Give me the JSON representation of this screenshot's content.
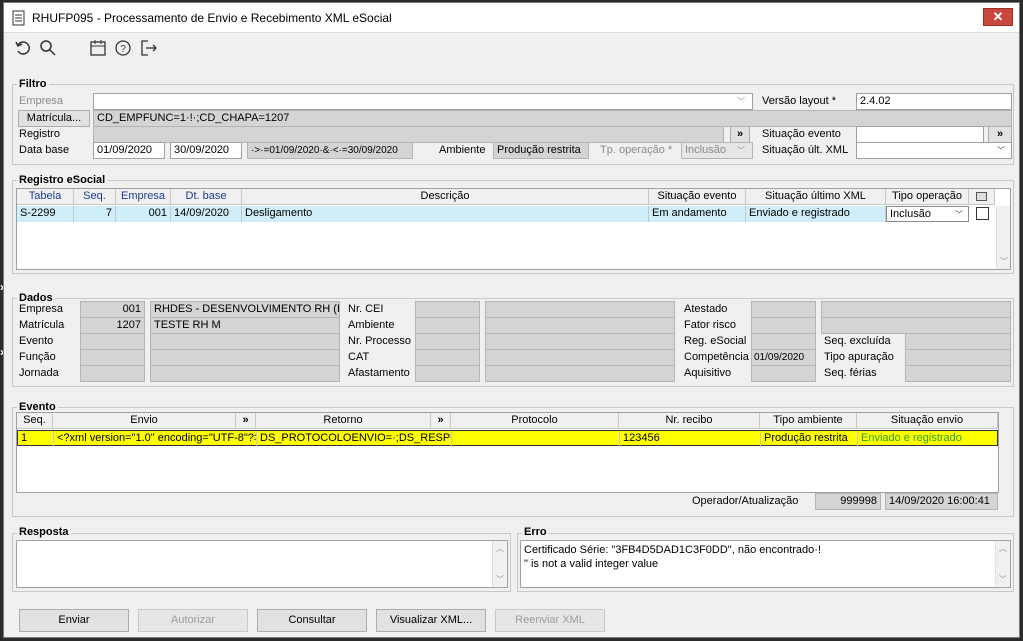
{
  "window": {
    "title": "RHUFP095 - Processamento de Envio e Recebimento XML eSocial",
    "close": "✕"
  },
  "toolbar": {
    "icons": [
      "undo-icon",
      "search-icon",
      "calendar-icon",
      "help-icon",
      "exit-icon"
    ]
  },
  "filtro": {
    "legend": "Filtro",
    "empresa_label": "Empresa",
    "empresa_value": "",
    "versao_label": "Versão layout *",
    "versao_value": "2.4.02",
    "matricula_button": "Matrícula...",
    "matricula_value": "CD_EMPFUNC=1·!·;CD_CHAPA=1207",
    "registro_label": "Registro",
    "registro_value": "",
    "registro_button": "»",
    "situacao_evento_label": "Situação evento",
    "situacao_evento_value": "",
    "situacao_evento_button": "»",
    "data_base_label": "Data base",
    "data_ini": "01/09/2020",
    "data_fim": "30/09/2020",
    "data_expr": "·>·=01/09/2020·&·<·=30/09/2020",
    "ambiente_label": "Ambiente",
    "ambiente_value": "Produção restrita",
    "tp_operacao_label": "Tp. operação *",
    "tp_operacao_value": "Inclusão",
    "situacao_ult_label": "Situação últ. XML",
    "situacao_ult_value": ""
  },
  "registro_esocial": {
    "legend": "Registro eSocial",
    "columns": [
      "Tabela",
      "Seq.",
      "Empresa",
      "Dt. base",
      "Descrição",
      "Situação evento",
      "Situação último XML",
      "Tipo operação"
    ],
    "rows": [
      {
        "tabela": "S-2299",
        "seq": "7",
        "empresa": "001",
        "dt_base": "14/09/2020",
        "descricao": "Desligamento",
        "situacao_evento": "Em andamento",
        "situacao_xml": "Enviado e registrado",
        "tipo_operacao": "Inclusão"
      }
    ]
  },
  "dados": {
    "legend": "Dados",
    "empresa_label": "Empresa",
    "empresa_code": "001",
    "empresa_name": "RHDES - DESENVOLVIMENTO RH (EMP",
    "matricula_label": "Matrícula",
    "matricula_code": "1207",
    "matricula_name": "TESTE RH M",
    "evento_label": "Evento",
    "funcao_label": "Função",
    "jornada_label": "Jornada",
    "nr_cei_label": "Nr. CEI",
    "ambiente_label": "Ambiente",
    "nr_processo_label": "Nr. Processo",
    "cat_label": "CAT",
    "afastamento_label": "Afastamento",
    "atestado_label": "Atestado",
    "fator_risco_label": "Fator risco",
    "reg_esocial_label": "Reg. eSocial",
    "competencia_label": "Competência",
    "competencia_value": "01/09/2020",
    "aquisitivo_label": "Aquisitivo",
    "seq_excluida_label": "Seq. excluída",
    "tipo_apuracao_label": "Tipo apuração",
    "seq_ferias_label": "Seq. férias"
  },
  "evento": {
    "legend": "Evento",
    "columns": [
      "Seq.",
      "Envio",
      "»",
      "Retorno",
      "»",
      "Protocolo",
      "Nr. recibo",
      "Tipo ambiente",
      "Situação envio"
    ],
    "rows": [
      {
        "seq": "1",
        "envio": "<?xml version=\"1.0\" encoding=\"UTF-8\"?>",
        "retorno": "DS_PROTOCOLOENVIO=·;DS_RESPOST",
        "protocolo": "",
        "nr_recibo": "123456",
        "tipo_ambiente": "Produção restrita",
        "situacao_envio": "Enviado e registrado"
      }
    ],
    "operador_label": "Operador/Atualização",
    "operador_value": "999998",
    "atualizacao_value": "14/09/2020 16:00:41"
  },
  "resposta": {
    "legend": "Resposta",
    "text": ""
  },
  "erro": {
    "legend": "Erro",
    "line1": "Certificado Série: \"3FB4D5DAD1C3F0DD\", não encontrado·!",
    "line2": "\" is not a valid integer value"
  },
  "buttons": {
    "enviar": "Enviar",
    "autorizar": "Autorizar",
    "consultar": "Consultar",
    "visualizar": "Visualizar XML...",
    "reenviar": "Reenviar XML"
  },
  "colors": {
    "row_selected_blue": "#cfeefa",
    "row_selected_yellow": "#ffff00",
    "status_green": "#2aa02a"
  }
}
